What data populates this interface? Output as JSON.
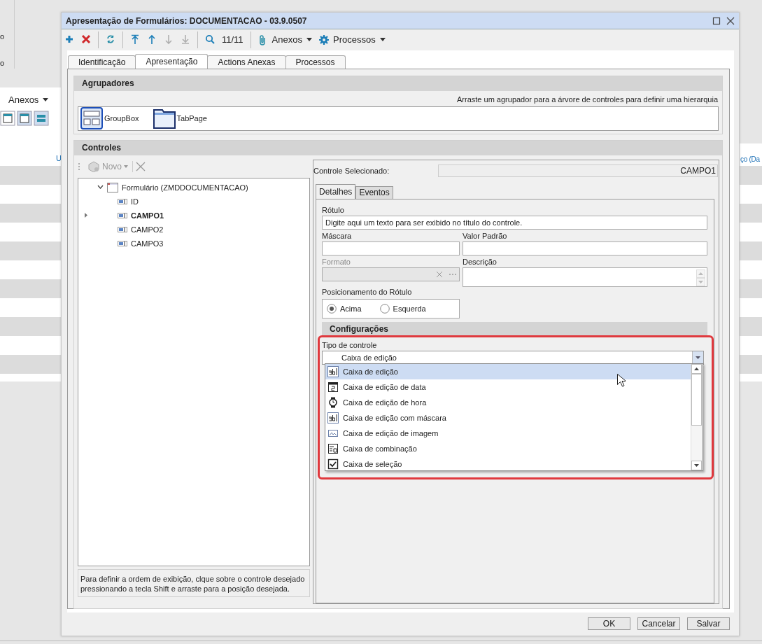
{
  "background": {
    "left_fragments": [
      "o",
      "o"
    ],
    "toolbar_menu": "Anexos",
    "header_fragment": "U",
    "column_fragment": "ço (Da"
  },
  "window": {
    "title": "Apresentação de Formulários: DOCUMENTACAO - 03.9.0507"
  },
  "toolbar": {
    "buttons": [
      {
        "kind": "add",
        "disabled": false
      },
      {
        "kind": "delete",
        "disabled": false
      },
      {
        "kind": "refresh",
        "disabled": false
      },
      {
        "kind": "first",
        "disabled": false
      },
      {
        "kind": "up",
        "disabled": false
      },
      {
        "kind": "down",
        "disabled": true
      },
      {
        "kind": "last",
        "disabled": true
      },
      {
        "kind": "search",
        "disabled": false
      }
    ],
    "record_position": "11/11",
    "menus": [
      {
        "kind": "attach",
        "label": "Anexos"
      },
      {
        "kind": "gear",
        "label": "Processos"
      }
    ]
  },
  "tabs": [
    {
      "label": "Identificação",
      "selected": false
    },
    {
      "label": "Apresentação",
      "selected": true
    },
    {
      "label": "Actions Anexas",
      "selected": false
    },
    {
      "label": "Processos",
      "selected": false
    }
  ],
  "agrupadores": {
    "title": "Agrupadores",
    "hint": "Arraste um agrupador para a árvore de controles para definir uma hierarquia",
    "items": [
      {
        "kind": "groupbox",
        "label": "GroupBox"
      },
      {
        "kind": "tabpage",
        "label": "TabPage"
      }
    ]
  },
  "controles": {
    "title": "Controles",
    "new_button": "Novo",
    "tree": {
      "label": "Formulário (ZMDDOCUMENTACAO)",
      "expanded": true,
      "children": [
        {
          "label": "ID",
          "selected": false
        },
        {
          "label": "CAMPO1",
          "selected": true
        },
        {
          "label": "CAMPO2",
          "selected": false
        },
        {
          "label": "CAMPO3",
          "selected": false
        }
      ]
    },
    "note": "Para definir a ordem de exibição, clque sobre o controle desejado pressionando a tecla Shift e arraste para a posição desejada."
  },
  "selected_control": {
    "label": "Controle Selecionado:",
    "value": "CAMPO1"
  },
  "detail_tabs": [
    {
      "label": "Detalhes",
      "selected": true
    },
    {
      "label": "Eventos",
      "selected": false
    }
  ],
  "fields": {
    "rotulo": {
      "label": "Rótulo",
      "value": "Digite aqui um texto para ser exibido no título do controle."
    },
    "mascara": {
      "label": "Máscara"
    },
    "valor_padrao": {
      "label": "Valor Padrão"
    },
    "formato": {
      "label": "Formato",
      "disabled": true
    },
    "descricao": {
      "label": "Descrição"
    }
  },
  "label_position": {
    "label": "Posicionamento do Rótulo",
    "options": [
      {
        "label": "Acima",
        "selected": true
      },
      {
        "label": "Esquerda",
        "selected": false
      }
    ]
  },
  "configuracoes": {
    "title": "Configurações",
    "field_label": "Tipo de controle",
    "value": "Caixa de edição",
    "options": [
      {
        "kind": "text",
        "label": "Caixa de edição",
        "selected": true
      },
      {
        "kind": "date",
        "label": "Caixa de edição de data",
        "selected": false
      },
      {
        "kind": "time",
        "label": "Caixa de edição de hora",
        "selected": false
      },
      {
        "kind": "text",
        "label": "Caixa de edição com máscara",
        "selected": false
      },
      {
        "kind": "image",
        "label": "Caixa de edição de imagem",
        "selected": false
      },
      {
        "kind": "combo",
        "label": "Caixa de combinação",
        "selected": false
      },
      {
        "kind": "checkbox",
        "label": "Caixa de seleção",
        "selected": false
      }
    ]
  },
  "buttons": [
    "OK",
    "Cancelar",
    "Salvar"
  ]
}
